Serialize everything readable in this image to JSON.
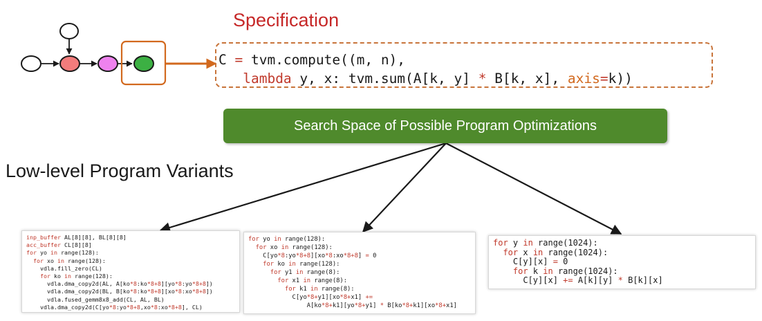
{
  "specification": {
    "title": "Specification",
    "code_lines": [
      [
        {
          "t": "C ",
          "c": ""
        },
        {
          "t": "=",
          "c": "op"
        },
        {
          "t": " tvm.compute((m, n),",
          "c": ""
        }
      ],
      [
        {
          "t": "   ",
          "c": ""
        },
        {
          "t": "lambda",
          "c": "kw"
        },
        {
          "t": " y, x: tvm.sum(A[k, y] ",
          "c": ""
        },
        {
          "t": "*",
          "c": "op"
        },
        {
          "t": " B[k, x], ",
          "c": ""
        },
        {
          "t": "axis",
          "c": "kwarg"
        },
        {
          "t": "=",
          "c": "op"
        },
        {
          "t": "k))",
          "c": ""
        }
      ]
    ]
  },
  "search_space_label": "Search Space of Possible Program Optimizations",
  "variants_title": "Low-level Program Variants",
  "graph": {
    "node_colors": [
      "#ffffff",
      "#ffffff",
      "#f27c7c",
      "#ee82ee",
      "#3cb043"
    ],
    "edge_color": "#1a1a1a",
    "highlight_color": "#d2691e"
  },
  "variants": [
    {
      "lines": [
        [
          {
            "t": "inp_buffer",
            "c": "kw"
          },
          {
            "t": " AL[8][8], BL[8][8]",
            "c": ""
          }
        ],
        [
          {
            "t": "acc_buffer",
            "c": "kw"
          },
          {
            "t": " CL[8][8]",
            "c": ""
          }
        ],
        [
          {
            "t": "for",
            "c": "kw"
          },
          {
            "t": " yo ",
            "c": ""
          },
          {
            "t": "in",
            "c": "kw"
          },
          {
            "t": " range(128):",
            "c": ""
          }
        ],
        [
          {
            "t": "  ",
            "c": ""
          },
          {
            "t": "for",
            "c": "kw"
          },
          {
            "t": " xo ",
            "c": ""
          },
          {
            "t": "in",
            "c": "kw"
          },
          {
            "t": " range(128):",
            "c": ""
          }
        ],
        [
          {
            "t": "    vdla.fill_zero(CL)",
            "c": ""
          }
        ],
        [
          {
            "t": "    ",
            "c": ""
          },
          {
            "t": "for",
            "c": "kw"
          },
          {
            "t": " ko ",
            "c": ""
          },
          {
            "t": "in",
            "c": "kw"
          },
          {
            "t": " range(128):",
            "c": ""
          }
        ],
        [
          {
            "t": "      vdla.dma_copy2d(AL, A[ko",
            "c": ""
          },
          {
            "t": "*8",
            "c": "op"
          },
          {
            "t": ":ko",
            "c": ""
          },
          {
            "t": "*8+8",
            "c": "op"
          },
          {
            "t": "][yo",
            "c": ""
          },
          {
            "t": "*8",
            "c": "op"
          },
          {
            "t": ":yo",
            "c": ""
          },
          {
            "t": "*8+8",
            "c": "op"
          },
          {
            "t": "])",
            "c": ""
          }
        ],
        [
          {
            "t": "      vdla.dma_copy2d(BL, B[ko",
            "c": ""
          },
          {
            "t": "*8",
            "c": "op"
          },
          {
            "t": ":ko",
            "c": ""
          },
          {
            "t": "*8+8",
            "c": "op"
          },
          {
            "t": "][xo",
            "c": ""
          },
          {
            "t": "*8",
            "c": "op"
          },
          {
            "t": ":xo",
            "c": ""
          },
          {
            "t": "*8+8",
            "c": "op"
          },
          {
            "t": "])",
            "c": ""
          }
        ],
        [
          {
            "t": "      vdla.fused_gemm8x8_add(CL, AL, BL)",
            "c": ""
          }
        ],
        [
          {
            "t": "    vdla.dma_copy2d(C[yo",
            "c": ""
          },
          {
            "t": "*8",
            "c": "op"
          },
          {
            "t": ":yo",
            "c": ""
          },
          {
            "t": "*8+8",
            "c": "op"
          },
          {
            "t": ",xo",
            "c": ""
          },
          {
            "t": "*8",
            "c": "op"
          },
          {
            "t": ":xo",
            "c": ""
          },
          {
            "t": "*8+8",
            "c": "op"
          },
          {
            "t": "], CL)",
            "c": ""
          }
        ]
      ]
    },
    {
      "lines": [
        [
          {
            "t": "for",
            "c": "kw"
          },
          {
            "t": " yo ",
            "c": ""
          },
          {
            "t": "in",
            "c": "kw"
          },
          {
            "t": " range(128):",
            "c": ""
          }
        ],
        [
          {
            "t": "  ",
            "c": ""
          },
          {
            "t": "for",
            "c": "kw"
          },
          {
            "t": " xo ",
            "c": ""
          },
          {
            "t": "in",
            "c": "kw"
          },
          {
            "t": " range(128):",
            "c": ""
          }
        ],
        [
          {
            "t": "    C[yo",
            "c": ""
          },
          {
            "t": "*8",
            "c": "op"
          },
          {
            "t": ":yo",
            "c": ""
          },
          {
            "t": "*8+8",
            "c": "op"
          },
          {
            "t": "][xo",
            "c": ""
          },
          {
            "t": "*8",
            "c": "op"
          },
          {
            "t": ":xo",
            "c": ""
          },
          {
            "t": "*8+8",
            "c": "op"
          },
          {
            "t": "] ",
            "c": ""
          },
          {
            "t": "=",
            "c": "op"
          },
          {
            "t": " 0",
            "c": ""
          }
        ],
        [
          {
            "t": "    ",
            "c": ""
          },
          {
            "t": "for",
            "c": "kw"
          },
          {
            "t": " ko ",
            "c": ""
          },
          {
            "t": "in",
            "c": "kw"
          },
          {
            "t": " range(128):",
            "c": ""
          }
        ],
        [
          {
            "t": "      ",
            "c": ""
          },
          {
            "t": "for",
            "c": "kw"
          },
          {
            "t": " y1 ",
            "c": ""
          },
          {
            "t": "in",
            "c": "kw"
          },
          {
            "t": " range(8):",
            "c": ""
          }
        ],
        [
          {
            "t": "        ",
            "c": ""
          },
          {
            "t": "for",
            "c": "kw"
          },
          {
            "t": " x1 ",
            "c": ""
          },
          {
            "t": "in",
            "c": "kw"
          },
          {
            "t": " range(8):",
            "c": ""
          }
        ],
        [
          {
            "t": "          ",
            "c": ""
          },
          {
            "t": "for",
            "c": "kw"
          },
          {
            "t": " k1 ",
            "c": ""
          },
          {
            "t": "in",
            "c": "kw"
          },
          {
            "t": " range(8):",
            "c": ""
          }
        ],
        [
          {
            "t": "            C[yo",
            "c": ""
          },
          {
            "t": "*8+",
            "c": "op"
          },
          {
            "t": "y1][xo",
            "c": ""
          },
          {
            "t": "*8+",
            "c": "op"
          },
          {
            "t": "x1] ",
            "c": ""
          },
          {
            "t": "+=",
            "c": "op"
          }
        ],
        [
          {
            "t": "                A[ko",
            "c": ""
          },
          {
            "t": "*8+",
            "c": "op"
          },
          {
            "t": "k1][yo",
            "c": ""
          },
          {
            "t": "*8+",
            "c": "op"
          },
          {
            "t": "y1] ",
            "c": ""
          },
          {
            "t": "*",
            "c": "op"
          },
          {
            "t": " B[ko",
            "c": ""
          },
          {
            "t": "*8+",
            "c": "op"
          },
          {
            "t": "k1][xo",
            "c": ""
          },
          {
            "t": "*8+",
            "c": "op"
          },
          {
            "t": "x1]",
            "c": ""
          }
        ]
      ]
    },
    {
      "lines": [
        [
          {
            "t": "for",
            "c": "kw"
          },
          {
            "t": " y ",
            "c": ""
          },
          {
            "t": "in",
            "c": "kw"
          },
          {
            "t": " range(1024):",
            "c": ""
          }
        ],
        [
          {
            "t": "  ",
            "c": ""
          },
          {
            "t": "for",
            "c": "kw"
          },
          {
            "t": " x ",
            "c": ""
          },
          {
            "t": "in",
            "c": "kw"
          },
          {
            "t": " range(1024):",
            "c": ""
          }
        ],
        [
          {
            "t": "    C[y][x] ",
            "c": ""
          },
          {
            "t": "=",
            "c": "op"
          },
          {
            "t": " 0",
            "c": ""
          }
        ],
        [
          {
            "t": "    ",
            "c": ""
          },
          {
            "t": "for",
            "c": "kw"
          },
          {
            "t": " k ",
            "c": ""
          },
          {
            "t": "in",
            "c": "kw"
          },
          {
            "t": " range(1024):",
            "c": ""
          }
        ],
        [
          {
            "t": "      C[y][x] ",
            "c": ""
          },
          {
            "t": "+=",
            "c": "op"
          },
          {
            "t": " A[k][y] ",
            "c": ""
          },
          {
            "t": "*",
            "c": "op"
          },
          {
            "t": " B[k][x]",
            "c": ""
          }
        ]
      ]
    }
  ]
}
